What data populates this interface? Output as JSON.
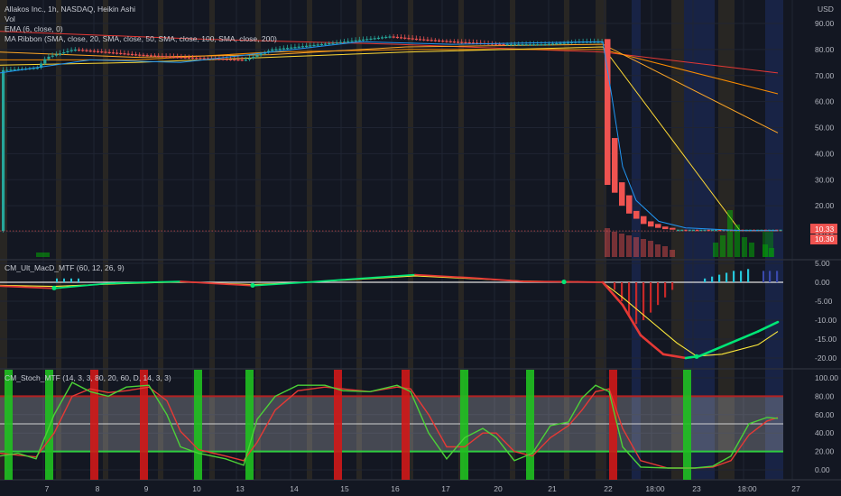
{
  "main_legend": {
    "title": "Allakos Inc., 1h, NASDAQ, Heikin Ashi",
    "vol": "Vol",
    "ema": "EMA (6, close, 0)",
    "ribbon": "MA Ribbon (SMA, close, 20, SMA, close, 50, SMA, close, 100, SMA, close, 200)"
  },
  "macd_label": "CM_Ult_MacD_MTF (60, 12, 26, 9)",
  "stoch_label": "CM_Stoch_MTF (14, 3, 3, 80, 20, 60, D, 14, 3, 3)",
  "currency": "USD",
  "colors": {
    "background": "#131722",
    "up": "#26a69a",
    "down": "#ef5350",
    "overbought_band": "#b22222",
    "oversold_band": "#2ecc40",
    "macd_line": "#00e676",
    "signal_line": "#ffeb3b"
  },
  "chart_data": [
    {
      "type": "candlestick",
      "title": "Allakos Inc., 1h, NASDAQ, Heikin Ashi",
      "y_axis_labels": [
        "90.00",
        "80.00",
        "70.00",
        "60.00",
        "50.00",
        "40.00",
        "30.00",
        "20.00",
        "10.00"
      ],
      "ylim": [
        6,
        95
      ],
      "y_scale": "linear",
      "x_tick_labels": [
        "7",
        "8",
        "9",
        "10",
        "13",
        "14",
        "15",
        "16",
        "17",
        "20",
        "21",
        "22",
        "18:00",
        "23",
        "18:00",
        "27"
      ],
      "price_tags": [
        "10.33",
        "10.30"
      ],
      "close_path": [
        [
          0,
          72
        ],
        [
          40,
          73
        ],
        [
          50,
          77
        ],
        [
          80,
          80
        ],
        [
          150,
          78
        ],
        [
          200,
          77
        ],
        [
          270,
          76
        ],
        [
          300,
          80
        ],
        [
          380,
          83
        ],
        [
          430,
          85
        ],
        [
          460,
          84
        ],
        [
          500,
          83
        ],
        [
          555,
          82
        ],
        [
          600,
          82
        ],
        [
          640,
          83
        ],
        [
          668,
          83
        ],
        [
          680,
          46
        ],
        [
          700,
          25
        ],
        [
          720,
          14
        ],
        [
          740,
          12
        ],
        [
          780,
          11
        ],
        [
          820,
          10.5
        ],
        [
          860,
          10.3
        ]
      ],
      "moving_averages": [
        {
          "name": "EMA 6",
          "color": "#2196f3"
        },
        {
          "name": "SMA 20",
          "color": "#ff9800"
        },
        {
          "name": "SMA 50",
          "color": "#ff9800"
        },
        {
          "name": "SMA 100",
          "color": "#ffd54f"
        },
        {
          "name": "SMA 200",
          "color": "#e53935"
        }
      ],
      "ribbon_ends": [
        48,
        63,
        71
      ]
    },
    {
      "type": "line",
      "title": "CM_Ult_MacD_MTF (60, 12, 26, 9)",
      "y_axis_labels": [
        "5.00",
        "0.00",
        "-5.00",
        "-10.00",
        "-15.00",
        "-20.00"
      ],
      "ylim": [
        -22,
        6
      ],
      "series": [
        {
          "name": "MACD",
          "values": [
            [
              0,
              -1
            ],
            [
              60,
              -1.6
            ],
            [
              120,
              -0.3
            ],
            [
              200,
              0.2
            ],
            [
              280,
              -0.9
            ],
            [
              340,
              0
            ],
            [
              400,
              1
            ],
            [
              460,
              2
            ],
            [
              520,
              1.2
            ],
            [
              580,
              0.2
            ],
            [
              640,
              0.1
            ],
            [
              668,
              0
            ],
            [
              690,
              -6
            ],
            [
              710,
              -14
            ],
            [
              735,
              -19
            ],
            [
              760,
              -20
            ],
            [
              775,
              -19.5
            ],
            [
              810,
              -16
            ],
            [
              840,
              -13
            ],
            [
              862,
              -10.5
            ]
          ]
        },
        {
          "name": "Signal",
          "values": [
            [
              0,
              -0.8
            ],
            [
              60,
              -1.1
            ],
            [
              120,
              -0.5
            ],
            [
              200,
              0.1
            ],
            [
              280,
              -0.6
            ],
            [
              340,
              0
            ],
            [
              400,
              0.8
            ],
            [
              460,
              1.7
            ],
            [
              520,
              1
            ],
            [
              580,
              0.3
            ],
            [
              640,
              0.1
            ],
            [
              668,
              0
            ],
            [
              690,
              -4
            ],
            [
              720,
              -10
            ],
            [
              750,
              -16
            ],
            [
              772,
              -19.5
            ],
            [
              800,
              -19
            ],
            [
              840,
              -16.5
            ],
            [
              862,
              -13
            ]
          ]
        }
      ],
      "histogram_bars": [
        {
          "x": 680,
          "v": -2
        },
        {
          "x": 688,
          "v": -5
        },
        {
          "x": 696,
          "v": -9
        },
        {
          "x": 704,
          "v": -11
        },
        {
          "x": 712,
          "v": -10
        },
        {
          "x": 720,
          "v": -8
        },
        {
          "x": 728,
          "v": -6
        },
        {
          "x": 736,
          "v": -4
        },
        {
          "x": 744,
          "v": -2
        },
        {
          "x": 780,
          "v": 1
        },
        {
          "x": 788,
          "v": 1.5
        },
        {
          "x": 796,
          "v": 2
        },
        {
          "x": 804,
          "v": 2.5
        },
        {
          "x": 812,
          "v": 3
        },
        {
          "x": 820,
          "v": 3
        },
        {
          "x": 828,
          "v": 3.5
        },
        {
          "x": 845,
          "v": 3
        },
        {
          "x": 852,
          "v": 3
        },
        {
          "x": 860,
          "v": 3
        }
      ]
    },
    {
      "type": "line",
      "title": "CM_Stoch_MTF (14, 3, 3, 80, 20, 60, D, 14, 3, 3)",
      "y_axis_labels": [
        "100.00",
        "80.00",
        "60.00",
        "40.00",
        "20.00",
        "0.00"
      ],
      "ylim": [
        -8,
        108
      ],
      "bands": {
        "overbought": 80,
        "oversold": 20,
        "midline": 50
      },
      "series": [
        {
          "name": "%K",
          "values": [
            [
              0,
              15
            ],
            [
              20,
              18
            ],
            [
              40,
              12
            ],
            [
              60,
              60
            ],
            [
              80,
              95
            ],
            [
              100,
              85
            ],
            [
              120,
              80
            ],
            [
              140,
              90
            ],
            [
              165,
              92
            ],
            [
              185,
              60
            ],
            [
              200,
              25
            ],
            [
              220,
              18
            ],
            [
              250,
              12
            ],
            [
              270,
              5
            ],
            [
              285,
              55
            ],
            [
              305,
              80
            ],
            [
              330,
              92
            ],
            [
              360,
              92
            ],
            [
              380,
              86
            ],
            [
              410,
              85
            ],
            [
              440,
              92
            ],
            [
              455,
              85
            ],
            [
              475,
              40
            ],
            [
              495,
              12
            ],
            [
              515,
              35
            ],
            [
              535,
              45
            ],
            [
              550,
              35
            ],
            [
              570,
              10
            ],
            [
              590,
              18
            ],
            [
              610,
              48
            ],
            [
              630,
              52
            ],
            [
              645,
              78
            ],
            [
              660,
              92
            ],
            [
              675,
              85
            ],
            [
              690,
              25
            ],
            [
              710,
              3
            ],
            [
              740,
              2
            ],
            [
              770,
              2
            ],
            [
              790,
              4
            ],
            [
              810,
              15
            ],
            [
              830,
              50
            ],
            [
              850,
              57
            ],
            [
              862,
              56
            ]
          ]
        },
        {
          "name": "%D",
          "values": [
            [
              0,
              18
            ],
            [
              20,
              16
            ],
            [
              40,
              14
            ],
            [
              60,
              40
            ],
            [
              80,
              80
            ],
            [
              100,
              88
            ],
            [
              120,
              84
            ],
            [
              140,
              86
            ],
            [
              165,
              90
            ],
            [
              185,
              75
            ],
            [
              200,
              42
            ],
            [
              220,
              22
            ],
            [
              250,
              15
            ],
            [
              270,
              10
            ],
            [
              285,
              30
            ],
            [
              305,
              65
            ],
            [
              330,
              86
            ],
            [
              360,
              90
            ],
            [
              380,
              88
            ],
            [
              410,
              85
            ],
            [
              440,
              90
            ],
            [
              455,
              88
            ],
            [
              475,
              60
            ],
            [
              495,
              25
            ],
            [
              515,
              25
            ],
            [
              535,
              40
            ],
            [
              550,
              40
            ],
            [
              570,
              20
            ],
            [
              590,
              15
            ],
            [
              610,
              35
            ],
            [
              630,
              48
            ],
            [
              645,
              65
            ],
            [
              660,
              85
            ],
            [
              675,
              88
            ],
            [
              690,
              45
            ],
            [
              710,
              10
            ],
            [
              740,
              2
            ],
            [
              770,
              2
            ],
            [
              790,
              3
            ],
            [
              810,
              10
            ],
            [
              830,
              38
            ],
            [
              850,
              53
            ],
            [
              862,
              57
            ]
          ]
        }
      ],
      "signal_markers": [
        {
          "x": 5,
          "color": "green"
        },
        {
          "x": 50,
          "color": "green"
        },
        {
          "x": 100,
          "color": "red"
        },
        {
          "x": 155,
          "color": "red"
        },
        {
          "x": 215,
          "color": "green"
        },
        {
          "x": 272,
          "color": "green"
        },
        {
          "x": 370,
          "color": "red"
        },
        {
          "x": 445,
          "color": "red"
        },
        {
          "x": 510,
          "color": "green"
        },
        {
          "x": 583,
          "color": "green"
        },
        {
          "x": 675,
          "color": "red"
        },
        {
          "x": 757,
          "color": "green"
        }
      ]
    }
  ]
}
